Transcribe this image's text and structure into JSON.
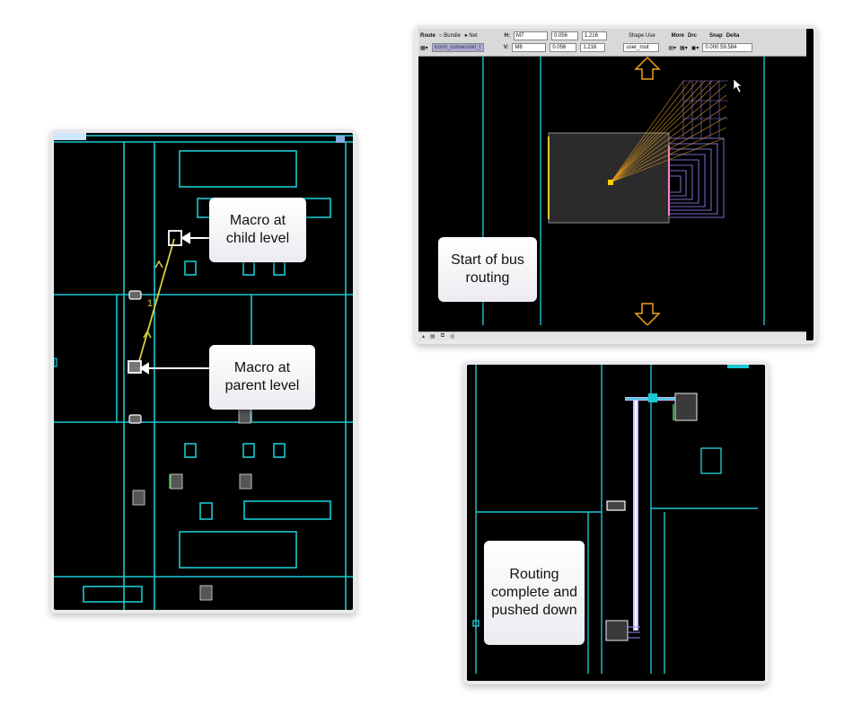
{
  "callouts": {
    "child": "Macro at child level",
    "parent": "Macro at parent level",
    "start": "Start of bus routing",
    "complete": "Routing complete and pushed down"
  },
  "left_panel": {
    "net_label": "17"
  },
  "toolbar": {
    "route_label": "Route",
    "bundle_label": "Bundle",
    "net_label": "Net",
    "h_label": "H:",
    "v_label": "V:",
    "h_layer": "M7",
    "v_layer": "M8",
    "h_width": "0.056",
    "h_spacing": "1.216",
    "v_width": "0.056",
    "v_spacing": "1.216",
    "shape_use_label": "Shape Use",
    "shape_use_value": "user_rout",
    "more_label": "More",
    "drc_label": "Drc",
    "snap_label": "Snap",
    "delta_label": "Delta",
    "delta_value": "0.000 59.584",
    "net_name": "iconn_conversion_l"
  },
  "colors": {
    "background": "#000000",
    "boundary": "#19c8d2",
    "route": "#d8d040",
    "bus_fan": "#f0a020",
    "bus_lines": "#9b8cff",
    "pushed_route": "#c9c0ff"
  }
}
